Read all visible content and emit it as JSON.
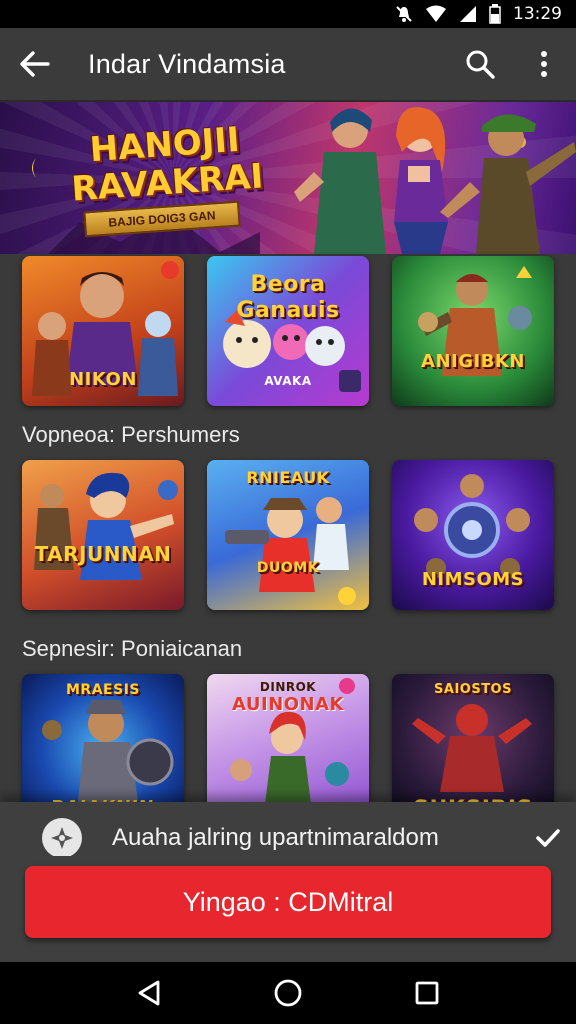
{
  "status_bar": {
    "time": "13:29",
    "icons": [
      "mute-icon",
      "wifi-icon",
      "signal-icon",
      "battery-icon"
    ]
  },
  "app_bar": {
    "title": "Indar Vindamsia",
    "back_icon": "arrow-left-icon",
    "search_icon": "search-icon",
    "menu_icon": "more-vertical-icon"
  },
  "banner": {
    "title": "HANOJII RAVAKRAI",
    "ribbon": "BAJIG DOIG3 GAN",
    "colors": {
      "bg": "#5a1f86",
      "title": "#ffcc33"
    }
  },
  "row1": [
    {
      "name": "NIKON",
      "theme": "orange"
    },
    {
      "name": "Beora Ganauis",
      "sub": "AVAKA",
      "theme": "purple"
    },
    {
      "name": "ANIGIBKN",
      "theme": "green"
    }
  ],
  "section1": {
    "title": "Vopneoa: Pershumers"
  },
  "row2": [
    {
      "name": "TARJUNNAN",
      "theme": "orange"
    },
    {
      "name": "RNIEAUK",
      "sub": "DUOMK",
      "theme": "blue"
    },
    {
      "name": "NIMSOMS",
      "theme": "violet"
    }
  ],
  "section2": {
    "title": "Sepnesir: Poniaicanan"
  },
  "row3": [
    {
      "name": "RAJAKNIN",
      "top": "MRAESIS",
      "theme": "blue"
    },
    {
      "name": "AUINONAK",
      "top": "DINROK",
      "theme": "pink"
    },
    {
      "name": "SUKSIRIS",
      "top": "SAIOSTOS",
      "theme": "dark"
    }
  ],
  "notice": {
    "text": "Auaha jalring upartnimaraldom",
    "icon": "shuriken-icon",
    "check_icon": "check-icon"
  },
  "cta": {
    "label": "Yingao : CDMitral",
    "color": "#e8262e"
  },
  "nav": {
    "icons": [
      "back-triangle-icon",
      "home-circle-icon",
      "recents-square-icon"
    ]
  }
}
